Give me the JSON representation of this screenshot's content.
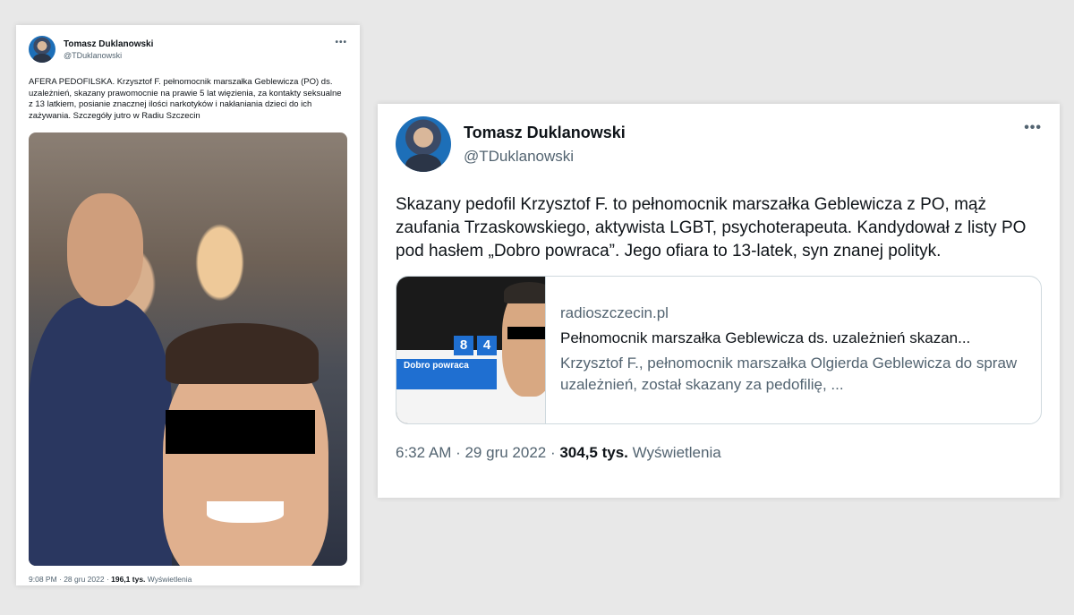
{
  "left_tweet": {
    "display_name": "Tomasz Duklanowski",
    "handle": "@TDuklanowski",
    "more_label": "•••",
    "text": "AFERA PEDOFILSKA. Krzysztof F. pełnomocnik marszałka Geblewicza (PO) ds. uzależnień, skazany prawomocnie na prawie 5 lat więzienia, za kontakty seksualne z 13 latkiem, posianie znacznej ilości narkotyków i nakłaniania dzieci do ich zażywania. Szczegóły jutro  w Radiu Szczecin",
    "time": "9:08 PM · 28 gru 2022 · ",
    "views_count": "196,1 tys.",
    "views_label": " Wyświetlenia"
  },
  "right_tweet": {
    "display_name": "Tomasz Duklanowski",
    "handle": "@TDuklanowski",
    "more_label": "•••",
    "text": "Skazany pedofil Krzysztof F. to pełnomocnik marszałka Geblewicza z PO, mąż zaufania Trzaskowskiego, aktywista LGBT, psychoterapeuta. Kandydował z listy PO pod hasłem „Dobro powraca”. Jego ofiara to 13-latek, syn znanej polityk.",
    "link_card": {
      "domain": "radioszczecin.pl",
      "title": "Pełnomocnik marszałka Geblewicza ds. uzależnień skazan...",
      "description": "Krzysztof F., pełnomocnik marszałka Olgierda Geblewicza do spraw uzależnień, został skazany za pedofilię, ...",
      "thumb_num_a": "8",
      "thumb_num_b": "4",
      "thumb_slogan": "Dobro powraca"
    },
    "time": "6:32 AM · 29 gru 2022 · ",
    "views_count": "304,5 tys.",
    "views_label": " Wyświetlenia"
  }
}
